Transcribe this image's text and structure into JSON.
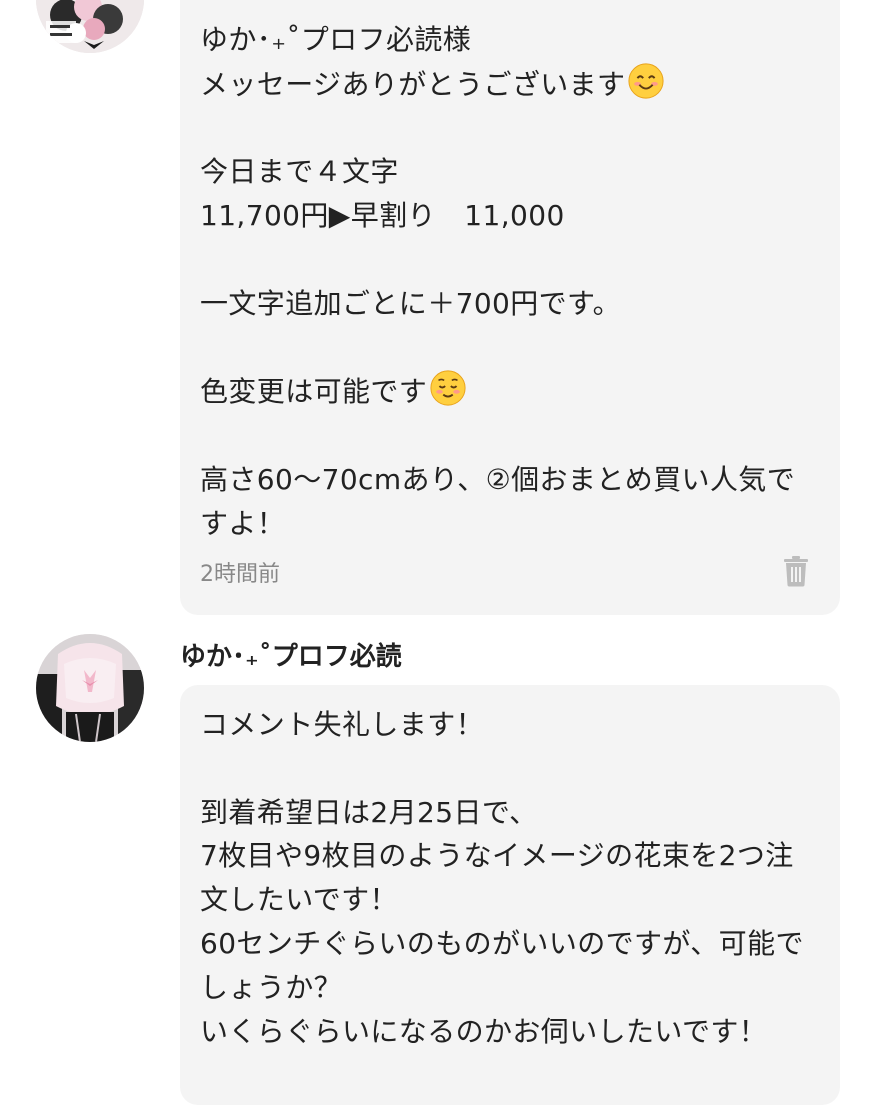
{
  "thread": [
    {
      "author": "",
      "text_before_emoji": "ゆか･₊˚プロフ必読様\nメッセージありがとうございます",
      "emoji_1": "smiling-face-icon",
      "text_middle": "\n\n今日まで４文字\n11,700円▶早割り　11,000\n\n一文字追加ごとに＋700円です。\n\n色変更は可能です",
      "emoji_2": "relieved-smile-icon",
      "text_after_emoji": "\n\n高さ60〜70cmあり、②個おまとめ買い人気ですよ！",
      "timestamp": "2時間前"
    },
    {
      "author": "ゆか･₊˚プロフ必読",
      "text": "コメント失礼します！\n\n到着希望日は2月25日で、\n7枚目や9枚目のようなイメージの花束を2つ注文したいです！\n60センチぐらいのものがいいのですが、可能でしょうか？\nいくらぐらいになるのかお伺いしたいです！"
    }
  ],
  "colors": {
    "bubble_background": "#f4f4f4",
    "text": "#222222",
    "timestamp": "#888888",
    "trash_icon": "#bdbdbd"
  }
}
